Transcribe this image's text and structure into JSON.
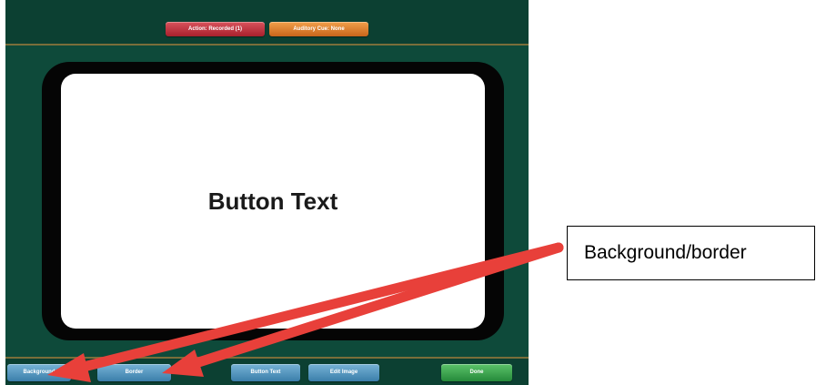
{
  "top_bar": {
    "action_button": "Action: Recorded (1)",
    "auditory_button": "Auditory Cue: None"
  },
  "card": {
    "text": "Button Text"
  },
  "bottom_bar": {
    "background_button": "Background",
    "border_button": "Border",
    "button_text_button": "Button Text",
    "edit_image_button": "Edit Image",
    "done_button": "Done"
  },
  "callout": {
    "text": "Background/border"
  },
  "colors": {
    "app_background": "#0e4a3a",
    "arrow": "#e8403a",
    "action_button": "#c0393f",
    "auditory_button": "#e0822f",
    "blue_button": "#4f92bf",
    "done_button": "#3aa84d"
  },
  "icons": {
    "arrow_1": "arrow-to-background-icon",
    "arrow_2": "arrow-to-border-icon"
  }
}
